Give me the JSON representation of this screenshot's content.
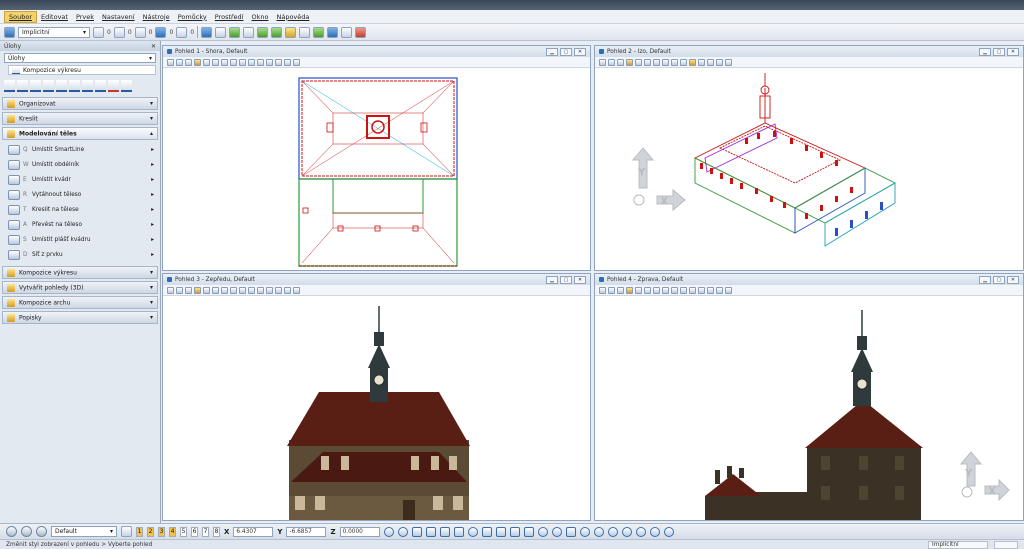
{
  "menubar": {
    "items": [
      "Soubor",
      "Editovat",
      "Prvek",
      "Nastavení",
      "Nástroje",
      "Pomůcky",
      "Prostředí",
      "Okno",
      "Nápověda"
    ]
  },
  "toolbar": {
    "level_value": "Implicitní",
    "counter_a": "0",
    "counter_b": "0",
    "counter_c": "0",
    "counter_d": "0",
    "counter_e": "0"
  },
  "left_panel": {
    "header": "Úlohy",
    "task_combo": "Úlohy",
    "subtask": "Kompozice výkresu",
    "sections": {
      "organize": "Organizovat",
      "draw": "Kreslit",
      "solid_modeling": "Modelování těles",
      "drawing_composition": "Kompozice výkresu",
      "create_views": "Vytvářit pohledy (3D)",
      "sheet_composition": "Kompozice archu",
      "annotations": "Popisky"
    },
    "tools": [
      {
        "key": "Q",
        "label": "Umístit SmartLine"
      },
      {
        "key": "W",
        "label": "Umístit obdélník"
      },
      {
        "key": "E",
        "label": "Umístit kvádr"
      },
      {
        "key": "R",
        "label": "Vytáhnout těleso"
      },
      {
        "key": "T",
        "label": "Kreslit na tělese"
      },
      {
        "key": "A",
        "label": "Převést na těleso"
      },
      {
        "key": "S",
        "label": "Umístit plášť kvádru"
      },
      {
        "key": "D",
        "label": "Síť z prvku"
      }
    ]
  },
  "views": [
    {
      "title": "Pohled 1 - Shora, Default"
    },
    {
      "title": "Pohled 2 - Izo, Default"
    },
    {
      "title": "Pohled 3 - Zepředu, Default"
    },
    {
      "title": "Pohled 4 - Zprava, Default"
    }
  ],
  "bottombar": {
    "view_combo": "Default",
    "view_numbers": [
      "1",
      "2",
      "3",
      "4",
      "5",
      "6",
      "7",
      "8"
    ],
    "x_label": "X",
    "x_value": "6.4307",
    "y_label": "Y",
    "y_value": "-6.6857",
    "z_label": "Z",
    "z_value": "0.0000"
  },
  "statusbar": {
    "message": "Změnit styl zobrazení v pohledu > Vyberte pohled",
    "level": "Implicitní"
  },
  "colors": {
    "accent": "#f2d26b",
    "roof": "#5a1f14",
    "wall": "#5b4a34",
    "tower": "#2f3a3d"
  }
}
